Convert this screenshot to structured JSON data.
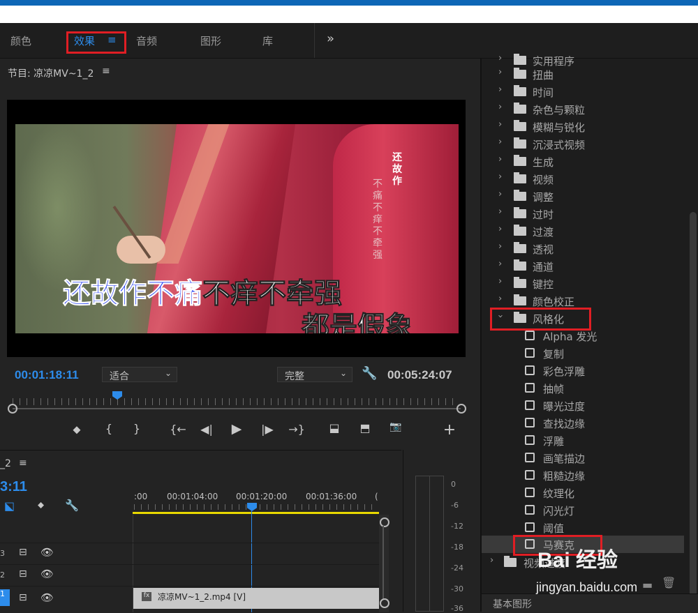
{
  "workspace": {
    "tabs": [
      {
        "label": "颜色"
      },
      {
        "label": "效果",
        "menu": "≡",
        "active": true
      },
      {
        "label": "音频"
      },
      {
        "label": "图形"
      },
      {
        "label": "库"
      }
    ],
    "overflow": "»"
  },
  "program": {
    "title": "节目: 凉凉MV~1_2",
    "menu": "≡",
    "subtitle_line1_blue": "还故作不痛",
    "subtitle_line1_white": "不痒不牵强",
    "subtitle_line2": "都是假象",
    "vertical_text_1": "还故作",
    "vertical_text_2": "不痛不痒不牵强",
    "current_time": "00:01:18:11",
    "fit_label": "适合",
    "quality_label": "完整",
    "duration": "00:05:24:07",
    "controls": {
      "marker": "⬥",
      "in": "{",
      "out": "}",
      "go_in": "{←",
      "step_back": "◀|",
      "play": "▶",
      "step_fwd": "|▶",
      "go_out": "→}",
      "lift": "⬓",
      "extract": "⬒",
      "camera": "📷",
      "add": "+"
    }
  },
  "timeline": {
    "title": "_2",
    "menu": "≡",
    "current_time": "3:11",
    "ruler_labels": [
      ":00",
      "00:01:04:00",
      "00:01:20:00",
      "00:01:36:00",
      "("
    ],
    "tracks": [
      {
        "name": "3"
      },
      {
        "name": "2"
      },
      {
        "name": "1"
      }
    ],
    "clip_label": "凉凉MV~1_2.mp4 [V]",
    "clip_fx": "fx"
  },
  "meter": {
    "ticks": [
      "0",
      "-6",
      "-12",
      "-18",
      "-24",
      "-30",
      "-36"
    ]
  },
  "effects": {
    "items": [
      {
        "label": "实用程序",
        "type": "folder",
        "expanded": false
      },
      {
        "label": "扭曲",
        "type": "folder",
        "expanded": false
      },
      {
        "label": "时间",
        "type": "folder",
        "expanded": false
      },
      {
        "label": "杂色与颗粒",
        "type": "folder",
        "expanded": false
      },
      {
        "label": "模糊与锐化",
        "type": "folder",
        "expanded": false
      },
      {
        "label": "沉浸式视频",
        "type": "folder",
        "expanded": false
      },
      {
        "label": "生成",
        "type": "folder",
        "expanded": false
      },
      {
        "label": "视频",
        "type": "folder",
        "expanded": false
      },
      {
        "label": "调整",
        "type": "folder",
        "expanded": false
      },
      {
        "label": "过时",
        "type": "folder",
        "expanded": false
      },
      {
        "label": "过渡",
        "type": "folder",
        "expanded": false
      },
      {
        "label": "透视",
        "type": "folder",
        "expanded": false
      },
      {
        "label": "通道",
        "type": "folder",
        "expanded": false
      },
      {
        "label": "键控",
        "type": "folder",
        "expanded": false
      },
      {
        "label": "颜色校正",
        "type": "folder",
        "expanded": false
      },
      {
        "label": "风格化",
        "type": "folder",
        "expanded": true
      },
      {
        "label": "Alpha 发光",
        "type": "effect"
      },
      {
        "label": "复制",
        "type": "effect"
      },
      {
        "label": "彩色浮雕",
        "type": "effect"
      },
      {
        "label": "抽帧",
        "type": "effect"
      },
      {
        "label": "曝光过度",
        "type": "effect"
      },
      {
        "label": "查找边缘",
        "type": "effect"
      },
      {
        "label": "浮雕",
        "type": "effect"
      },
      {
        "label": "画笔描边",
        "type": "effect"
      },
      {
        "label": "粗糙边缘",
        "type": "effect"
      },
      {
        "label": "纹理化",
        "type": "effect"
      },
      {
        "label": "闪光灯",
        "type": "effect"
      },
      {
        "label": "阈值",
        "type": "effect"
      },
      {
        "label": "马赛克",
        "type": "effect",
        "selected": true
      },
      {
        "label": "视频过渡",
        "type": "folder",
        "expanded": false
      }
    ],
    "footer": "基本图形"
  },
  "watermark": {
    "logo": "Bai 经验",
    "url": "jingyan.baidu.com"
  },
  "colors": {
    "accent_blue": "#2d8ceb",
    "highlight_red": "#e01e24",
    "timeline_yellow": "#e8d800"
  }
}
